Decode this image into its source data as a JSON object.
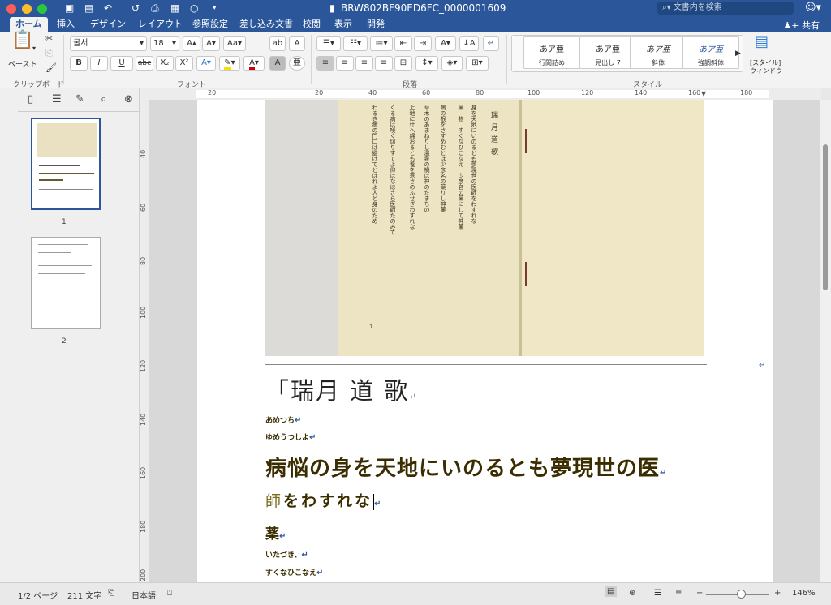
{
  "window": {
    "title": "BRW802BF90ED6FC_0000001609",
    "search_placeholder": "文書内を検索",
    "share_label": "共有"
  },
  "tabs": [
    {
      "label": "ホーム",
      "active": true
    },
    {
      "label": "挿入"
    },
    {
      "label": "デザイン"
    },
    {
      "label": "レイアウト"
    },
    {
      "label": "参照設定"
    },
    {
      "label": "差し込み文書"
    },
    {
      "label": "校閲"
    },
    {
      "label": "表示"
    },
    {
      "label": "開発"
    }
  ],
  "ribbon": {
    "clipboard": {
      "paste_label": "ペースト",
      "group_label": "クリップボード"
    },
    "font": {
      "font_name": "굴서",
      "font_size": "18",
      "group_label": "フォント",
      "bold": "B",
      "italic": "I",
      "underline": "U",
      "strike": "abc",
      "subscript": "X₂",
      "superscript": "X²",
      "kana": "亜"
    },
    "paragraph": {
      "group_label": "段落"
    },
    "styles": {
      "group_label": "スタイル",
      "items": [
        {
          "preview": "あア亜",
          "name": "行間詰め"
        },
        {
          "preview": "あア亜",
          "name": "見出し 7"
        },
        {
          "preview": "あア亜",
          "name": "斜体"
        },
        {
          "preview": "あア亜",
          "name": "強調斜体"
        }
      ],
      "pane_label": "[スタイル] ウィンドウ"
    }
  },
  "ruler": {
    "h_labels": [
      "20",
      "20",
      "40",
      "60",
      "80",
      "100",
      "120",
      "140",
      "160",
      "180"
    ],
    "v_labels": [
      "40",
      "60",
      "80",
      "100",
      "120",
      "140",
      "160",
      "180",
      "200"
    ]
  },
  "nav_pane": {
    "thumbnails": [
      {
        "number": "1",
        "selected": true
      },
      {
        "number": "2",
        "selected": false
      }
    ]
  },
  "document": {
    "photo_page": {
      "page_number": "1",
      "title_vertical": "瑞月道歌",
      "vertical_columns": [
        "身を天地にいのるとも夢現世の医師をわすれな",
        "薬　物　すくなひこなえ　少彦名の薬にして神薬",
        "病の根をさすめむとは少彦名の薬りし神薬",
        "草木のあまねりし温泉の禍は神のたまちの",
        "上地に仕へ綿おるとも養を寒さのふせぎわすれな",
        "くる病は咲く切りすてよ仰はなほさら医師たのみて",
        "わるき病の門口は避けてとはれよ人と身のため"
      ]
    },
    "lines": [
      {
        "text": "「瑞月 道 歌"
      },
      {
        "text": "あめつち"
      },
      {
        "text": "ゆめうつしよ"
      },
      {
        "text": "病悩の身を天地にいのるとも夢現世の医"
      },
      {
        "prefix": "師",
        "text": "をわすれな"
      },
      {
        "text": "薬"
      },
      {
        "text": "いたづき、"
      },
      {
        "text": "すくなひこなえ"
      }
    ]
  },
  "status": {
    "page": "1/2 ページ",
    "words": "211 文字",
    "language": "日本語",
    "zoom": "146%",
    "zoom_level": 0.55
  }
}
